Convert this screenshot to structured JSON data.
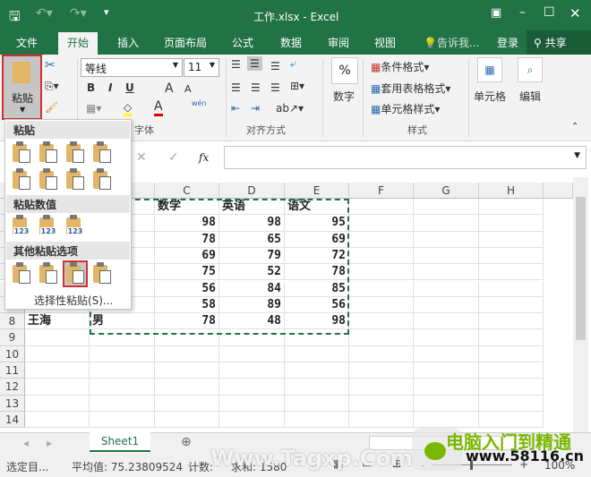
{
  "title": "工作.xlsx - Excel",
  "tabs": [
    "文件",
    "开始",
    "插入",
    "页面布局",
    "公式",
    "数据",
    "审阅",
    "视图"
  ],
  "tell_me": "告诉我...",
  "login": "登录",
  "share": "共享",
  "ribbon": {
    "paste": "粘贴",
    "font_name": "等线",
    "font_size": "11",
    "bold": "B",
    "italic": "I",
    "underline": "U",
    "grow": "A",
    "shrink": "A",
    "wen": "wén",
    "number": "数字",
    "percent": "%",
    "cond_format": "条件格式",
    "table_format": "套用表格格式",
    "cell_style": "单元格样式",
    "cells": "单元格",
    "edit": "编辑",
    "groups": {
      "font": "字体",
      "align": "对齐方式",
      "styles": "样式"
    }
  },
  "formula": {
    "cancel": "✕",
    "enter": "✓",
    "fx": "fx",
    "value": ""
  },
  "columns": [
    "C",
    "D",
    "E",
    "F",
    "G",
    "H"
  ],
  "rows": [
    "8",
    "9",
    "10",
    "11",
    "12",
    "13",
    "14"
  ],
  "table": {
    "headers": [
      "数学",
      "英语",
      "语文"
    ],
    "data": [
      [
        98,
        98,
        95
      ],
      [
        78,
        65,
        69
      ],
      [
        69,
        79,
        72
      ],
      [
        75,
        52,
        78
      ],
      [
        56,
        84,
        85
      ],
      [
        58,
        89,
        56
      ],
      [
        78,
        48,
        98
      ]
    ],
    "row8": {
      "name": "王海",
      "gender": "男"
    }
  },
  "paste_menu": {
    "section1": "粘贴",
    "section2": "粘贴数值",
    "section3": "其他粘贴选项",
    "special": "选择性粘贴(S)...",
    "icons": [
      [
        "paste-icon",
        "paste-formulas-icon",
        "paste-formulas-number-format-icon",
        "keep-source-formatting-icon"
      ],
      [
        "no-borders-icon",
        "keep-column-widths-icon",
        "transpose-icon",
        "merge-formatting-icon"
      ],
      [
        "paste-values-icon",
        "values-number-format-icon",
        "values-source-formatting-icon"
      ],
      [
        "formatting-icon",
        "paste-link-icon",
        "picture-icon",
        "linked-picture-icon"
      ]
    ],
    "value_labels": [
      "123",
      "123",
      "123"
    ]
  },
  "sheet": "Sheet1",
  "status": {
    "mode": "选定目...",
    "average": "平均值: 75.23809524",
    "count": "计数:",
    "sum": "求和: 1580",
    "zoom": "100%"
  },
  "watermark": {
    "text1": "Www.Tagxp.Com",
    "text2": "电脑入门到精通",
    "url": "www.58116.cn"
  },
  "colors": {
    "excel_green": "#217346",
    "selection_red": "#c0392b"
  }
}
